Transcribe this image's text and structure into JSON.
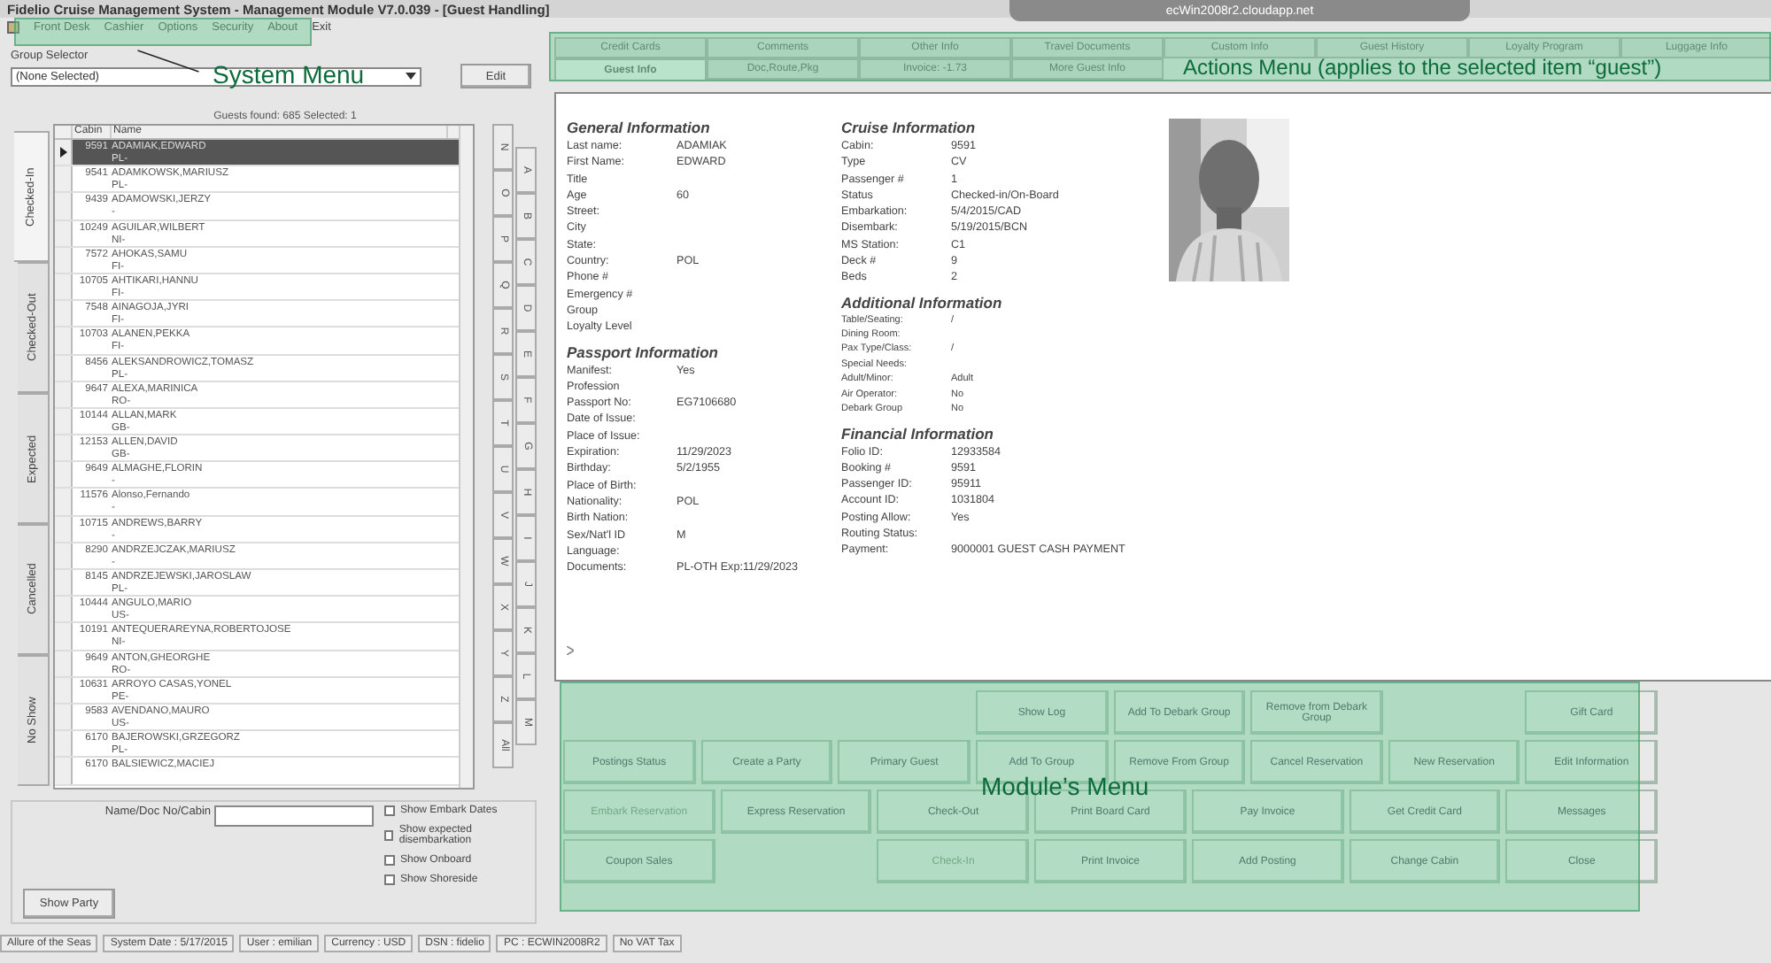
{
  "window": {
    "title": "Fidelio Cruise Management System - Management Module V7.0.039 - [Guest Handling]",
    "remote_host": "ecWin2008r2.cloudapp.net"
  },
  "menu": [
    "Front Desk",
    "Cashier",
    "Options",
    "Security",
    "About",
    "Exit"
  ],
  "group_selector": {
    "label": "Group Selector",
    "value": "(None Selected)",
    "button": "Edit"
  },
  "guests_found": "Guests found: 685 Selected: 1",
  "status_tabs": [
    {
      "label": "Checked-In",
      "selected": true
    },
    {
      "label": "Checked-Out",
      "selected": false
    },
    {
      "label": "Expected",
      "selected": false
    },
    {
      "label": "Cancelled",
      "selected": false
    },
    {
      "label": "No Show",
      "selected": false
    }
  ],
  "table": {
    "columns": [
      "Cabin",
      "Name"
    ],
    "rows": [
      {
        "cabin": "9591",
        "name": "ADAMIAK,EDWARD",
        "nat": "PL-",
        "selected": true
      },
      {
        "cabin": "9541",
        "name": "ADAMKOWSK,MARIUSZ",
        "nat": "PL-",
        "selected": false
      },
      {
        "cabin": "9439",
        "name": "ADAMOWSKI,JERZY",
        "nat": "-",
        "selected": false
      },
      {
        "cabin": "10249",
        "name": "AGUILAR,WILBERT",
        "nat": "NI-",
        "selected": false
      },
      {
        "cabin": "7572",
        "name": "AHOKAS,SAMU",
        "nat": "FI-",
        "selected": false
      },
      {
        "cabin": "10705",
        "name": "AHTIKARI,HANNU",
        "nat": "FI-",
        "selected": false
      },
      {
        "cabin": "7548",
        "name": "AINAGOJA,JYRI",
        "nat": "FI-",
        "selected": false
      },
      {
        "cabin": "10703",
        "name": "ALANEN,PEKKA",
        "nat": "FI-",
        "selected": false
      },
      {
        "cabin": "8456",
        "name": "ALEKSANDROWICZ,TOMASZ",
        "nat": "PL-",
        "selected": false
      },
      {
        "cabin": "9647",
        "name": "ALEXA,MARINICA",
        "nat": "RO-",
        "selected": false
      },
      {
        "cabin": "10144",
        "name": "ALLAN,MARK",
        "nat": "GB-",
        "selected": false
      },
      {
        "cabin": "12153",
        "name": "ALLEN,DAVID",
        "nat": "GB-",
        "selected": false
      },
      {
        "cabin": "9649",
        "name": "ALMAGHE,FLORIN",
        "nat": "-",
        "selected": false
      },
      {
        "cabin": "11576",
        "name": "Alonso,Fernando",
        "nat": "-",
        "selected": false
      },
      {
        "cabin": "10715",
        "name": "ANDREWS,BARRY",
        "nat": "-",
        "selected": false
      },
      {
        "cabin": "8290",
        "name": "ANDRZEJCZAK,MARIUSZ",
        "nat": "-",
        "selected": false
      },
      {
        "cabin": "8145",
        "name": "ANDRZEJEWSKI,JAROSLAW",
        "nat": "PL-",
        "selected": false
      },
      {
        "cabin": "10444",
        "name": "ANGULO,MARIO",
        "nat": "US-",
        "selected": false
      },
      {
        "cabin": "10191",
        "name": "ANTEQUERAREYNA,ROBERTOJOSE",
        "nat": "NI-",
        "selected": false
      },
      {
        "cabin": "9649",
        "name": "ANTON,GHEORGHE",
        "nat": "RO-",
        "selected": false
      },
      {
        "cabin": "10631",
        "name": "ARROYO CASAS,YONEL",
        "nat": "PE-",
        "selected": false
      },
      {
        "cabin": "9583",
        "name": "AVENDANO,MAURO",
        "nat": "US-",
        "selected": false
      },
      {
        "cabin": "6170",
        "name": "BAJEROWSKI,GRZEGORZ",
        "nat": "PL-",
        "selected": false
      },
      {
        "cabin": "6170",
        "name": "BALSIEWICZ,MACIEJ",
        "selected": false
      }
    ]
  },
  "alphabet_left": [
    "N",
    "O",
    "P",
    "Q",
    "R",
    "S",
    "T",
    "U",
    "V",
    "W",
    "X",
    "Y",
    "Z",
    "All"
  ],
  "alphabet_right": [
    "A",
    "B",
    "C",
    "D",
    "E",
    "F",
    "G",
    "H",
    "I",
    "J",
    "K",
    "L",
    "M"
  ],
  "filter": {
    "label": "Name/Doc No/Cabin",
    "button": "Show Party",
    "checkboxes": [
      {
        "label": "Show Embark Dates",
        "checked": false
      },
      {
        "label": "Show expected disembarkation",
        "checked": false
      },
      {
        "label": "Show Onboard",
        "checked": false
      },
      {
        "label": "Show Shoreside",
        "checked": false
      }
    ]
  },
  "action_tabs_top": [
    {
      "label": "Credit Cards",
      "selected": false
    },
    {
      "label": "Comments",
      "selected": false
    },
    {
      "label": "Other Info",
      "selected": false
    },
    {
      "label": "Travel Documents",
      "selected": false
    },
    {
      "label": "Custom Info",
      "selected": false
    },
    {
      "label": "Guest History",
      "selected": false
    },
    {
      "label": "Loyalty Program",
      "selected": false
    },
    {
      "label": "Luggage Info",
      "selected": false
    }
  ],
  "action_tabs_bottom": [
    {
      "label": "Guest Info",
      "selected": true
    },
    {
      "label": "Doc,Route,Pkg",
      "selected": false
    },
    {
      "label": "Invoice: -1.73",
      "selected": false
    },
    {
      "label": "More Guest Info",
      "selected": false
    }
  ],
  "info_columns": [
    [
      {
        "title": "General Information",
        "kind": "normal",
        "rows": [
          {
            "label": "Last name:",
            "value": "ADAMIAK"
          },
          {
            "label": "First Name:",
            "value": "EDWARD"
          },
          {
            "label": "Title"
          },
          {
            "label": "Age",
            "value": "60"
          },
          {
            "label": "Street:"
          },
          {
            "label": "City"
          },
          {
            "label": "State:"
          },
          {
            "label": "Country:",
            "value": "POL"
          },
          {
            "label": "Phone #"
          },
          {
            "label": "Emergency #"
          },
          {
            "label": "Group"
          },
          {
            "label": "Loyalty Level"
          }
        ]
      },
      {
        "title": "Passport Information",
        "kind": "normal",
        "rows": [
          {
            "label": "Manifest:",
            "value": "Yes"
          },
          {
            "label": "Profession"
          },
          {
            "label": "Passport No:",
            "value": "EG7106680"
          },
          {
            "label": "Date of Issue:"
          },
          {
            "label": "Place of Issue:"
          },
          {
            "label": "Expiration:",
            "value": "11/29/2023"
          },
          {
            "label": "Birthday:",
            "value": "5/2/1955"
          },
          {
            "label": "Place of Birth:"
          },
          {
            "label": "Nationality:",
            "value": "POL"
          },
          {
            "label": "Birth Nation:"
          },
          {
            "label": "Sex/Nat'l ID",
            "value": "M"
          },
          {
            "label": "Language:"
          },
          {
            "label": "Documents:",
            "value": "PL-OTH Exp:11/29/2023"
          }
        ]
      }
    ],
    [
      {
        "title": "Cruise Information",
        "kind": "normal",
        "rows": [
          {
            "label": "Cabin:",
            "value": "9591"
          },
          {
            "label": "Type",
            "value": "CV"
          },
          {
            "label": "Passenger #",
            "value": "1"
          },
          {
            "label": "Status",
            "value": "Checked-in/On-Board"
          },
          {
            "label": "Embarkation:",
            "value": "5/4/2015/CAD"
          },
          {
            "label": "Disembark:",
            "value": "5/19/2015/BCN"
          },
          {
            "label": "MS Station:",
            "value": "C1"
          },
          {
            "label": "Deck #",
            "value": "9"
          },
          {
            "label": "Beds",
            "value": "2"
          }
        ]
      },
      {
        "title": "Additional Information",
        "kind": "compact",
        "rows": [
          {
            "label": "Table/Seating:",
            "value": "/"
          },
          {
            "label": "Dining Room:"
          },
          {
            "label": "Pax Type/Class:",
            "value": "/"
          },
          {
            "label": "Special Needs:"
          },
          {
            "label": "Adult/Minor:",
            "value": "Adult"
          },
          {
            "label": "Air Operator:",
            "value": "No"
          },
          {
            "label": "Debark Group",
            "value": "No"
          }
        ]
      },
      {
        "title": "Financial Information",
        "kind": "normal",
        "rows": [
          {
            "label": "Folio ID:",
            "value": "12933584"
          },
          {
            "label": "Booking #",
            "value": "9591"
          },
          {
            "label": "Passenger ID:",
            "value": "95911"
          },
          {
            "label": "Account ID:",
            "value": "1031804"
          },
          {
            "label": "Posting Allow:",
            "value": "Yes"
          },
          {
            "label": "Routing Status:"
          },
          {
            "label": "Payment:",
            "value": "9000001 GUEST CASH PAYMENT"
          }
        ]
      }
    ]
  ],
  "photo": {
    "kind": "picture"
  },
  "module_menu": [
    [
      {
        "kind": "blank"
      },
      {
        "kind": "blank"
      },
      {
        "kind": "blank"
      },
      {
        "kind": "button",
        "label": "Show Log",
        "disabled": false
      },
      {
        "kind": "button",
        "label": "Add To Debark Group",
        "disabled": false
      },
      {
        "kind": "button",
        "label": "Remove from Debark Group",
        "disabled": false
      },
      {
        "kind": "blank"
      },
      {
        "kind": "button",
        "label": "Gift Card",
        "disabled": false
      }
    ],
    [
      {
        "kind": "button",
        "label": "Postings Status",
        "disabled": false
      },
      {
        "kind": "button",
        "label": "Create a Party",
        "disabled": false
      },
      {
        "kind": "button",
        "label": "Primary Guest",
        "disabled": false
      },
      {
        "kind": "button",
        "label": "Add To Group",
        "disabled": false
      },
      {
        "kind": "button",
        "label": "Remove From Group",
        "disabled": false
      },
      {
        "kind": "button",
        "label": "Cancel Reservation",
        "disabled": false
      },
      {
        "kind": "button",
        "label": "New Reservation",
        "disabled": false
      },
      {
        "kind": "button",
        "label": "Edit Information",
        "disabled": false
      }
    ],
    [
      {
        "kind": "button",
        "label": "Embark Reservation",
        "disabled": true
      },
      {
        "kind": "button",
        "label": "Express Reservation",
        "disabled": false
      },
      {
        "kind": "button",
        "label": "Check-Out",
        "disabled": false
      },
      {
        "kind": "button",
        "label": "Print Board Card",
        "disabled": false
      },
      {
        "kind": "button",
        "label": "Pay Invoice",
        "disabled": false
      },
      {
        "kind": "button",
        "label": "Get Credit Card",
        "disabled": false
      },
      {
        "kind": "button",
        "label": "Messages",
        "disabled": false
      }
    ],
    [
      {
        "kind": "button",
        "label": "Coupon Sales",
        "disabled": false
      },
      {
        "kind": "blank"
      },
      {
        "kind": "button",
        "label": "Check-In",
        "disabled": true
      },
      {
        "kind": "button",
        "label": "Print Invoice",
        "disabled": false
      },
      {
        "kind": "button",
        "label": "Add Posting",
        "disabled": false
      },
      {
        "kind": "button",
        "label": "Change Cabin",
        "disabled": false
      },
      {
        "kind": "button",
        "label": "Close",
        "disabled": false
      }
    ]
  ],
  "annotations": {
    "system_menu": "System Menu",
    "actions_menu": "Actions Menu (applies to the selected item “guest”)",
    "module_menu": "Module’s Menu"
  },
  "status_bar": [
    "Allure of the Seas",
    "System Date : 5/17/2015",
    "User : emilian",
    "Currency : USD",
    "DSN : fidelio",
    "PC : ECWIN2008R2",
    "No VAT Tax"
  ]
}
